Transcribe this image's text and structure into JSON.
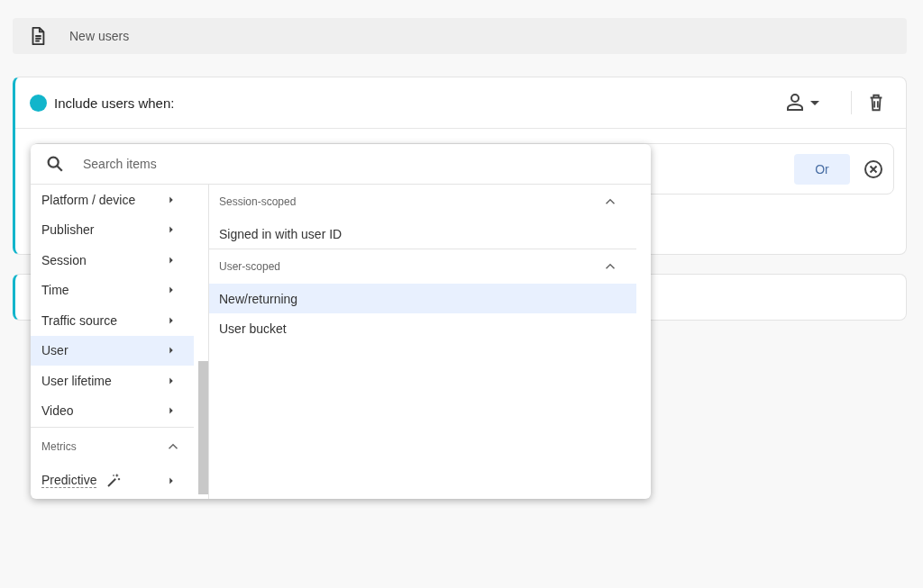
{
  "header": {
    "title": "New users"
  },
  "condition_group": {
    "title": "Include users when:",
    "or_button": "Or"
  },
  "dropdown": {
    "search": {
      "placeholder": "Search items"
    },
    "categories": [
      {
        "label": "Platform / device",
        "selected": false
      },
      {
        "label": "Publisher",
        "selected": false
      },
      {
        "label": "Session",
        "selected": false
      },
      {
        "label": "Time",
        "selected": false
      },
      {
        "label": "Traffic source",
        "selected": false
      },
      {
        "label": "User",
        "selected": true
      },
      {
        "label": "User lifetime",
        "selected": false
      },
      {
        "label": "Video",
        "selected": false
      }
    ],
    "metrics": {
      "heading": "Metrics",
      "expanded": true,
      "items": [
        {
          "label": "Predictive",
          "selected": false
        }
      ]
    },
    "sections": [
      {
        "heading": "Session-scoped",
        "expanded": true,
        "items": [
          {
            "label": "Signed in with user ID",
            "selected": false
          }
        ]
      },
      {
        "heading": "User-scoped",
        "expanded": true,
        "items": [
          {
            "label": "New/returning",
            "selected": true
          },
          {
            "label": "User bucket",
            "selected": false
          }
        ]
      }
    ]
  }
}
